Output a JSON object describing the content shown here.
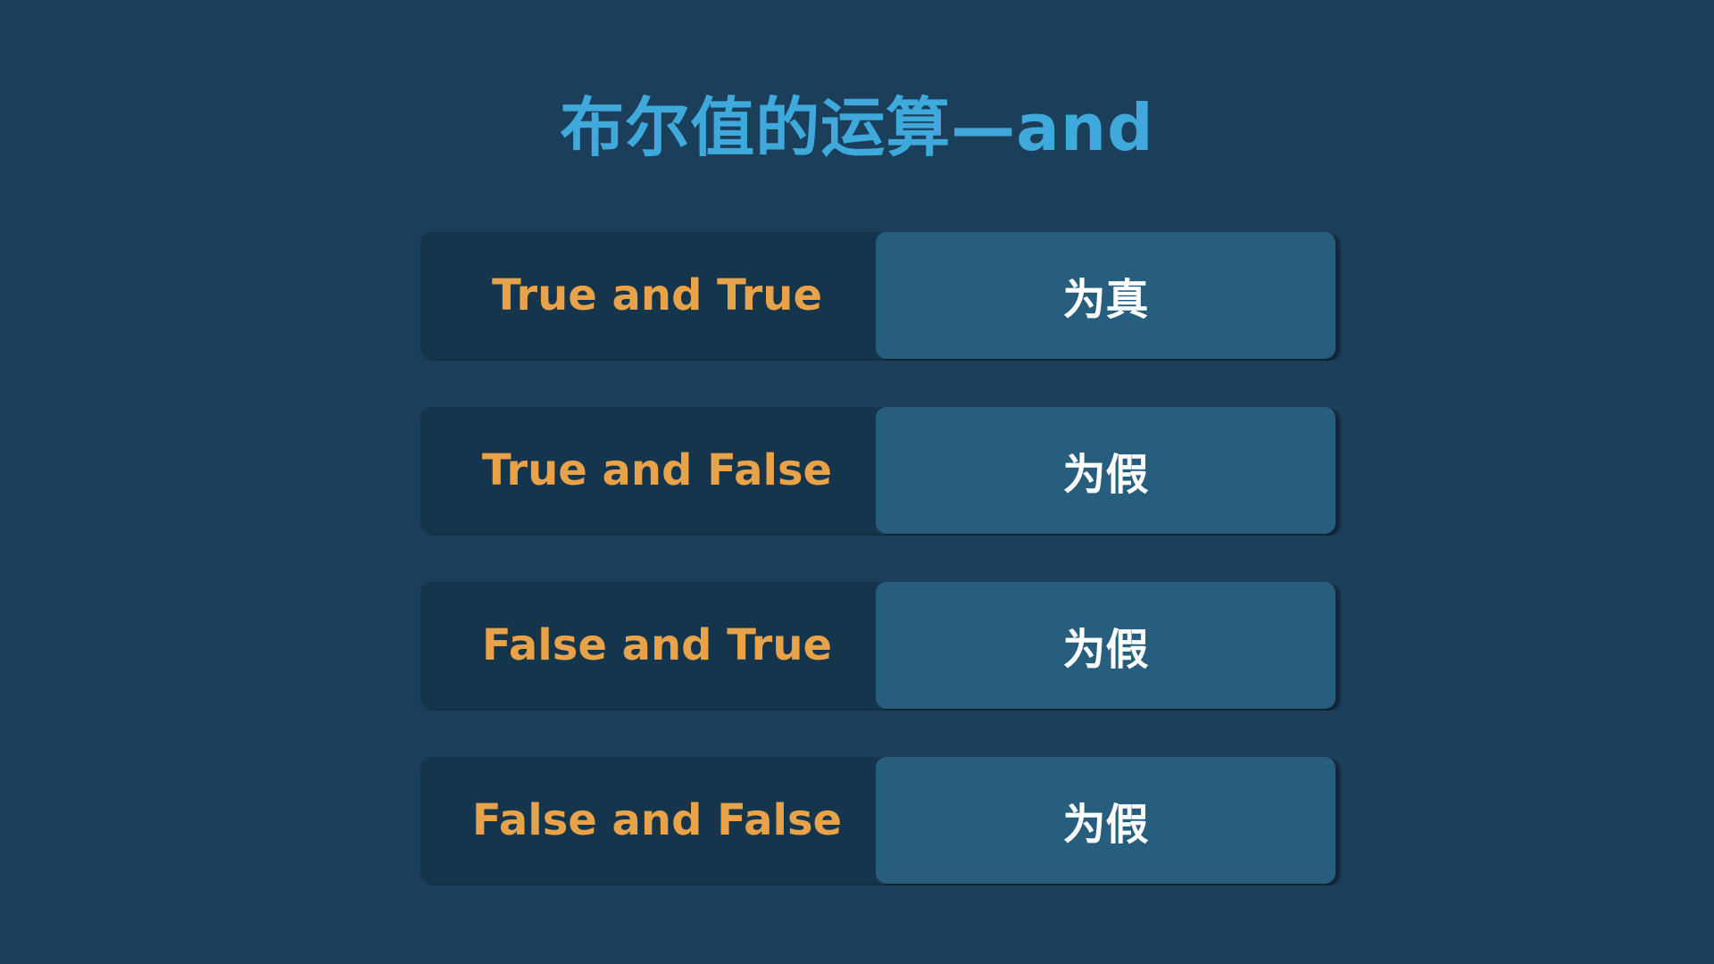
{
  "title": "布尔值的运算—and",
  "rows": [
    {
      "expression": "True and True",
      "result": "为真"
    },
    {
      "expression": "True and False",
      "result": "为假"
    },
    {
      "expression": "False and True",
      "result": "为假"
    },
    {
      "expression": "False and False",
      "result": "为假"
    }
  ],
  "colors": {
    "background": "#1b3f5a",
    "title": "#3fa9dc",
    "expression_text": "#e8a24a",
    "expression_bg": "#14354b",
    "result_bg": "#275d7d",
    "result_text": "#ffffff"
  }
}
